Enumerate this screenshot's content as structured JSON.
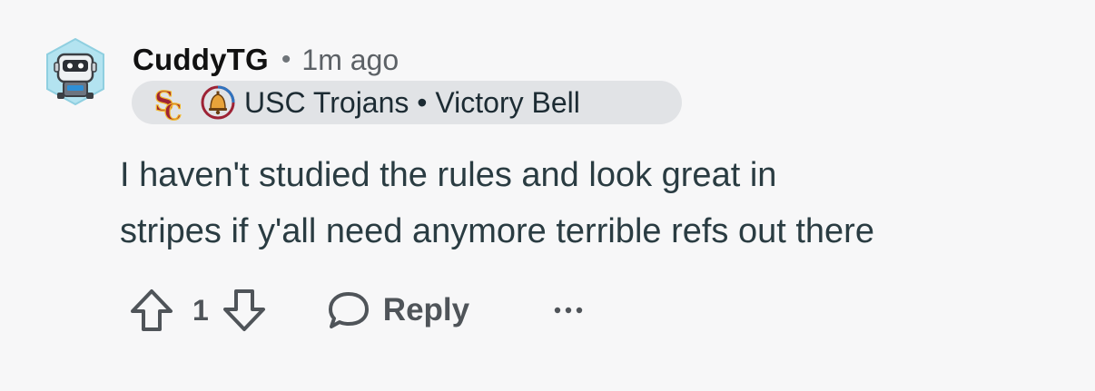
{
  "comment": {
    "username": "CuddyTG",
    "separator": "•",
    "timestamp": "1m ago",
    "avatar_icon": "robot-avatar-icon",
    "flair": {
      "emojis": [
        "usc-sc-logo-icon",
        "victory-bell-icon"
      ],
      "text": "USC Trojans • Victory Bell",
      "background": "#e1e3e6"
    },
    "body_lines": [
      "I haven't studied the rules and look great in",
      "stripes if y'all need anymore terrible refs out there"
    ],
    "actions": {
      "upvote_icon": "upvote-arrow-icon",
      "vote_count": "1",
      "downvote_icon": "downvote-arrow-icon",
      "reply_icon": "speech-bubble-icon",
      "reply_label": "Reply",
      "more_label": "···",
      "more_icon": "more-options-icon"
    },
    "colors": {
      "background": "#f7f7f8",
      "text": "#2a3c42",
      "muted": "#5c6166",
      "sc_red": "#9d2235",
      "sc_gold": "#f1b82d"
    }
  }
}
